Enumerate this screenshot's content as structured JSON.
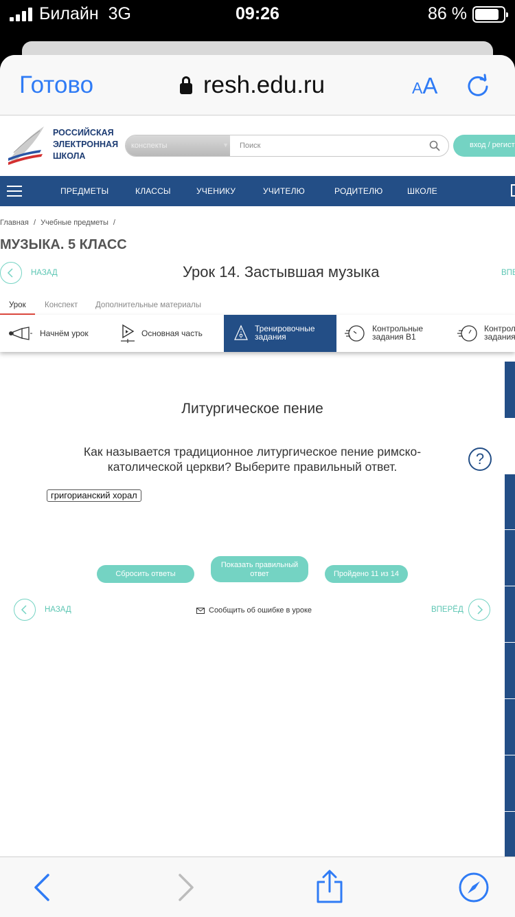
{
  "status_bar": {
    "carrier": "Билайн",
    "network": "3G",
    "time": "09:26",
    "battery": "86 %",
    "battery_level": 0.86
  },
  "browser": {
    "done_label": "Готово",
    "url": "resh.edu.ru",
    "text_size_small": "A",
    "text_size_big": "A",
    "reload_icon": "reload-icon"
  },
  "site": {
    "logo_line1": "РОССИЙСКАЯ",
    "logo_line2": "ЭЛЕКТРОННАЯ",
    "logo_line3": "ШКОЛА",
    "search_select": "конспекты",
    "search_placeholder": "Поиск",
    "login_label": "вход / регист"
  },
  "nav": {
    "items": [
      "ПРЕДМЕТЫ",
      "КЛАССЫ",
      "УЧЕНИКУ",
      "УЧИТЕЛЮ",
      "РОДИТЕЛЮ",
      "ШКОЛЕ"
    ]
  },
  "breadcrumbs": [
    "Главная",
    "/",
    "Учебные предметы",
    "/"
  ],
  "course_title": "МУЗЫКА. 5 КЛАСС",
  "lesson": {
    "back_label": "НАЗАД",
    "title": "Урок 14. Застывшая музыка",
    "forward_label": "ВПЕ"
  },
  "tabs": [
    "Урок",
    "Конспект",
    "Дополнительные материалы"
  ],
  "steps": [
    {
      "label": "Начнём урок"
    },
    {
      "label": "Основная часть"
    },
    {
      "line1": "Тренировочные",
      "line2": "задания"
    },
    {
      "line1": "Контрольные",
      "line2": "задания В1"
    },
    {
      "line1": "Контрол",
      "line2": "задания"
    }
  ],
  "task": {
    "title": "Литургическое пение",
    "question": "Как называется традиционное литургическое пение римско-католической церкви? Выберите правильный ответ.",
    "help": "?",
    "answer": "григорианский хорал"
  },
  "actions": {
    "reset": "Сбросить ответы",
    "show_line1": "Показать правильный",
    "show_line2": "ответ",
    "progress": "Пройдено 11 из 14"
  },
  "footer_nav": {
    "back": "НАЗАД",
    "report": "Сообщить об ошибке в уроке",
    "forward": "ВПЕРЁД"
  },
  "colors": {
    "accent_teal": "#74d3c3",
    "nav_blue": "#234e86",
    "ios_blue": "#2f7bf5"
  }
}
